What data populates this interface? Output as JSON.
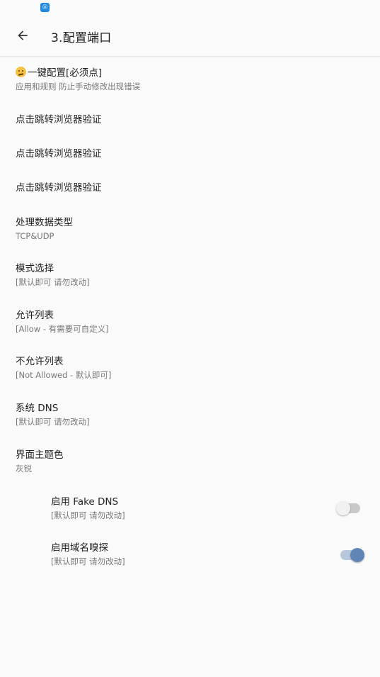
{
  "status_bar": {
    "app_icon": "notification-app-icon"
  },
  "app_bar": {
    "title": "3.配置端口",
    "back_icon": "arrow-left-icon"
  },
  "items": [
    {
      "title": "一键配置[必须点]",
      "summary": "应用和规则 防止手动修改出现错误",
      "emoji": "confused-face-icon"
    },
    {
      "title": "点击跳转浏览器验证"
    },
    {
      "title": "点击跳转浏览器验证"
    },
    {
      "title": "点击跳转浏览器验证"
    },
    {
      "title": "处理数据类型",
      "summary": "TCP&UDP"
    },
    {
      "title": "模式选择",
      "summary": "[默认即可 请勿改动]"
    },
    {
      "title": "允许列表",
      "summary": "[Allow - 有需要可自定义]"
    },
    {
      "title": "不允许列表",
      "summary": "[Not Allowed - 默认即可]"
    },
    {
      "title": "系统 DNS",
      "summary": "[默认即可 请勿改动]"
    },
    {
      "title": "界面主题色",
      "summary": "灰锐"
    },
    {
      "title": "启用 Fake DNS",
      "summary": "[默认即可 请勿改动]",
      "switch": "off"
    },
    {
      "title": "启用域名嗅探",
      "summary": "[默认即可 请勿改动]",
      "switch": "on"
    }
  ],
  "colors": {
    "switch_on_thumb": "#5f86b6",
    "switch_on_track": "#b7c7dc",
    "switch_off_track": "#c9c9c9"
  }
}
